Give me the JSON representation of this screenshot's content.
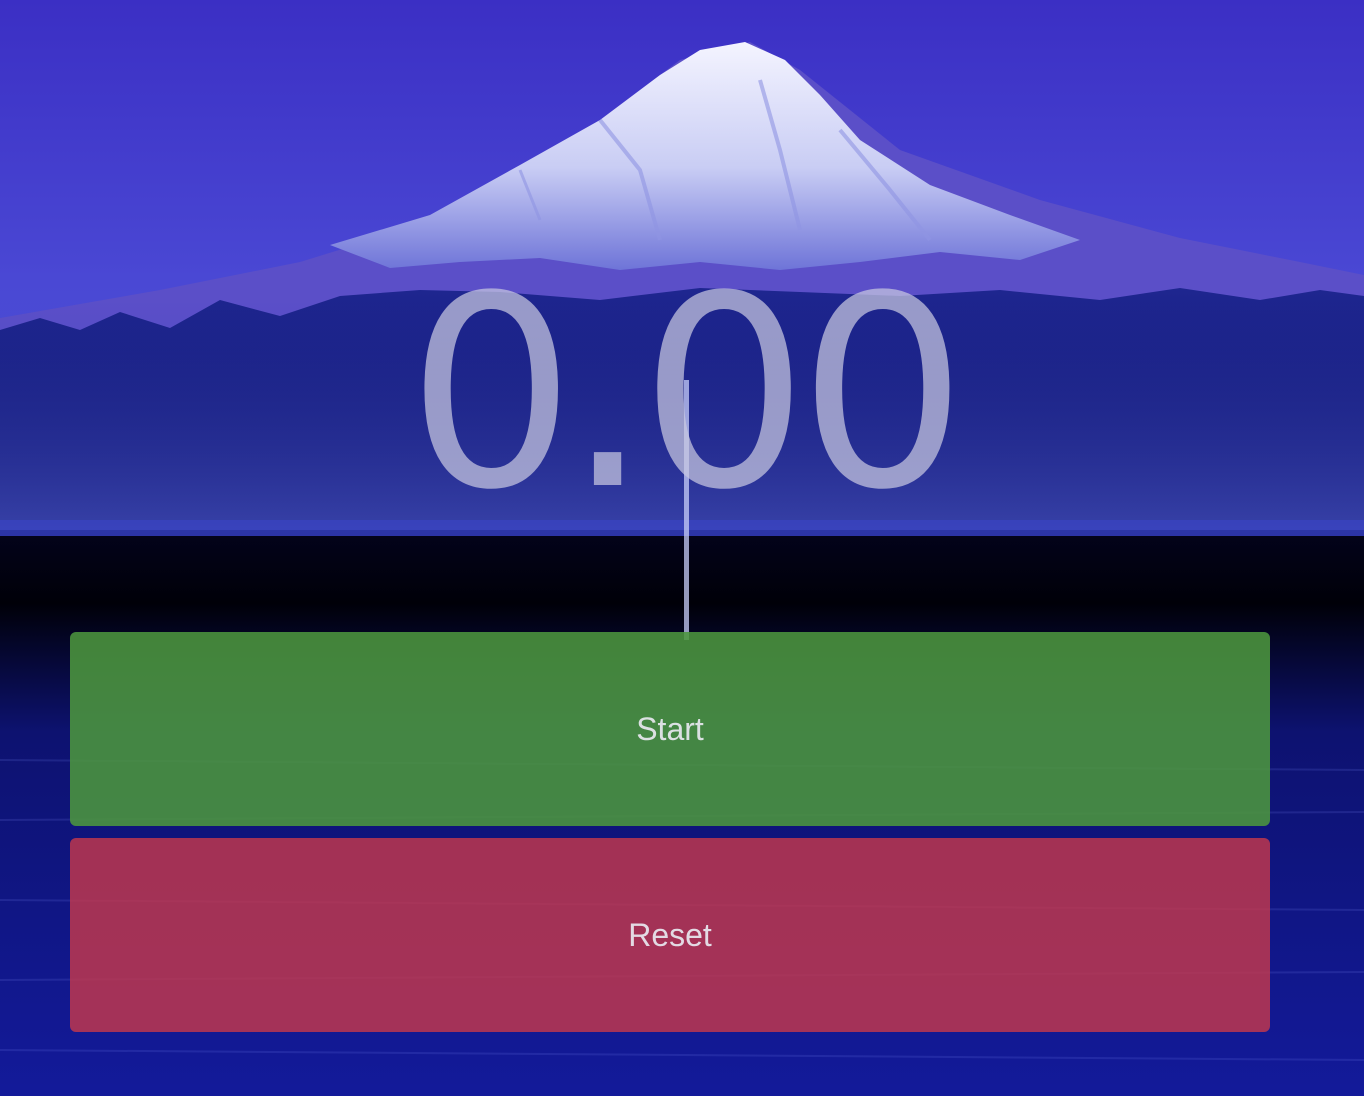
{
  "stopwatch": {
    "time_display": "0.00",
    "start_label": "Start",
    "reset_label": "Reset"
  },
  "colors": {
    "start_button": "#4c963e",
    "reset_button": "#c4384c",
    "timer_text": "#c8c8e1",
    "sky": "#3a30c0",
    "water": "#0a0a5a"
  },
  "background": {
    "icon": "mountain-lake-photo"
  }
}
